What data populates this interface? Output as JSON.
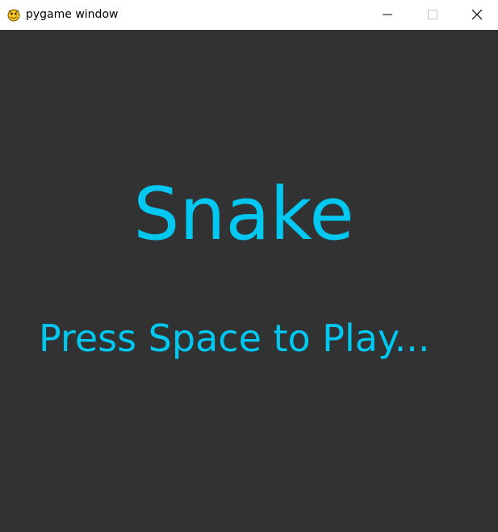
{
  "window": {
    "title": "pygame window",
    "app_icon": "pygame-snake-icon",
    "controls": {
      "minimize_icon": "minimize-icon",
      "maximize_icon": "maximize-icon",
      "close_icon": "close-icon"
    }
  },
  "game": {
    "title": "Snake",
    "prompt": "Press Space to Play..."
  },
  "colors": {
    "background": "#323232",
    "text": "#00c8f0",
    "titlebar": "#ffffff"
  }
}
